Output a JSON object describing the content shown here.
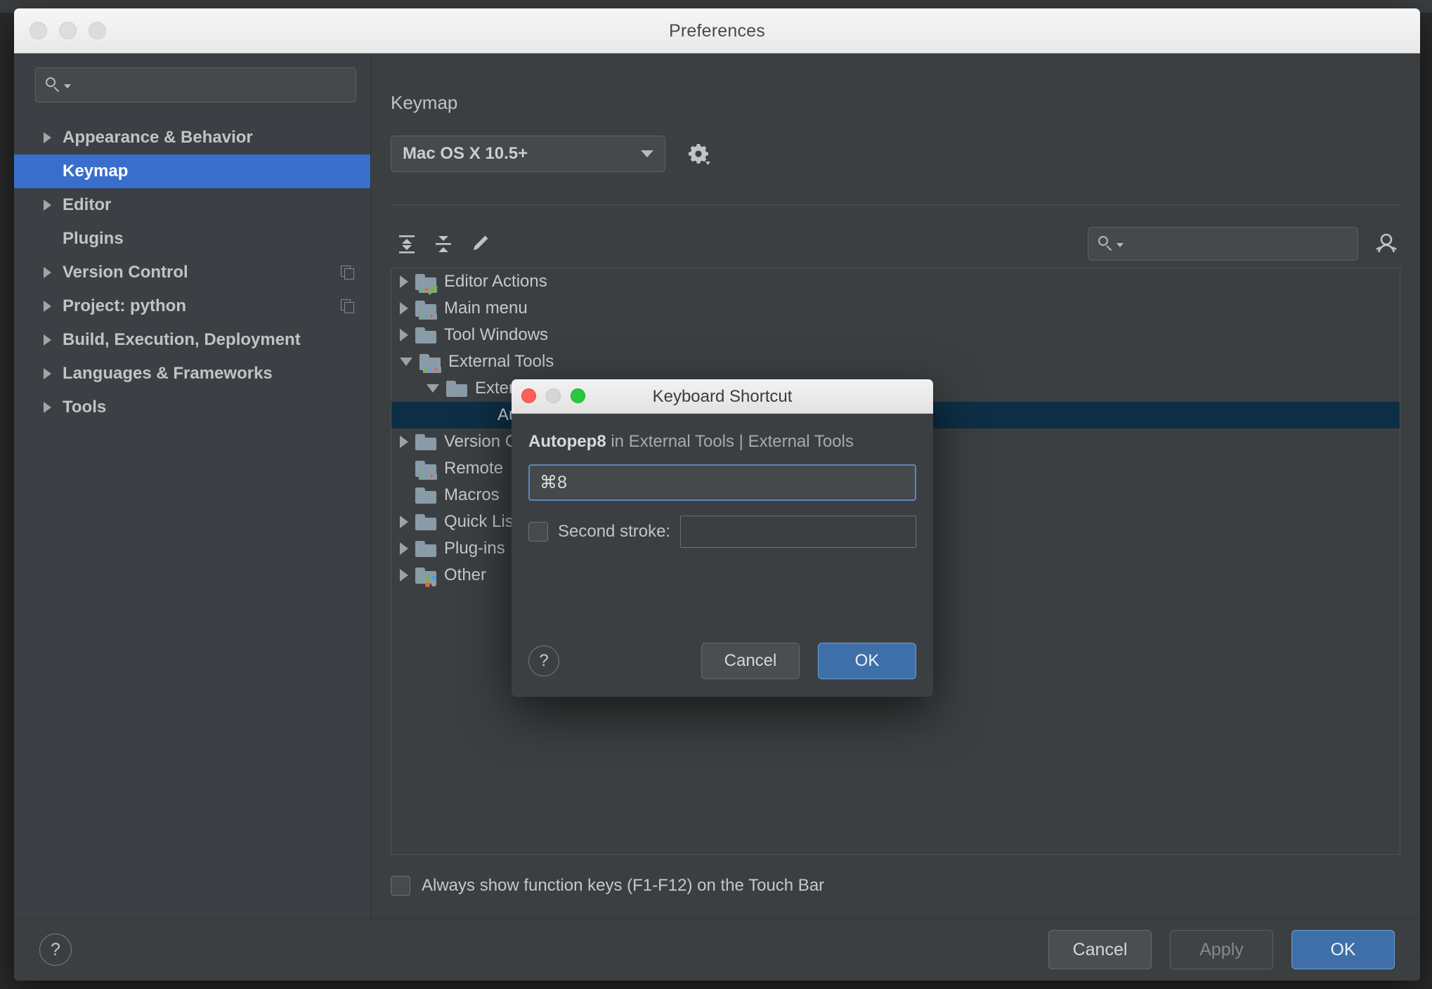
{
  "window": {
    "title": "Preferences",
    "traffic_lights": [
      "close",
      "minimize",
      "zoom"
    ]
  },
  "sidebar": {
    "search": {
      "placeholder": "",
      "value": "",
      "icon": "search-icon"
    },
    "items": [
      {
        "label": "Appearance & Behavior",
        "expandable": true,
        "selected": false,
        "badge": false
      },
      {
        "label": "Keymap",
        "expandable": false,
        "selected": true,
        "badge": false
      },
      {
        "label": "Editor",
        "expandable": true,
        "selected": false,
        "badge": false
      },
      {
        "label": "Plugins",
        "expandable": false,
        "selected": false,
        "badge": false
      },
      {
        "label": "Version Control",
        "expandable": true,
        "selected": false,
        "badge": true
      },
      {
        "label": "Project: python",
        "expandable": true,
        "selected": false,
        "badge": true
      },
      {
        "label": "Build, Execution, Deployment",
        "expandable": true,
        "selected": false,
        "badge": false
      },
      {
        "label": "Languages & Frameworks",
        "expandable": true,
        "selected": false,
        "badge": false
      },
      {
        "label": "Tools",
        "expandable": true,
        "selected": false,
        "badge": false
      }
    ]
  },
  "content": {
    "title": "Keymap",
    "keymap_select": {
      "value": "Mac OS X 10.5+",
      "caret": "chevron-down-icon"
    },
    "gear_icon": "gear-icon",
    "toolbar": {
      "expand_all": "expand-all-icon",
      "collapse_all": "collapse-all-icon",
      "edit": "pencil-icon",
      "search": {
        "placeholder": "",
        "value": "",
        "icon": "search-icon"
      },
      "find_actions": "find-action-icon"
    },
    "tree": [
      {
        "label": "Editor Actions",
        "indent": 0,
        "twisty": "right",
        "icon": "folder-editor-icon",
        "selected": false
      },
      {
        "label": "Main menu",
        "indent": 0,
        "twisty": "right",
        "icon": "folder-menu-icon",
        "selected": false
      },
      {
        "label": "Tool Windows",
        "indent": 0,
        "twisty": "right",
        "icon": "folder-icon",
        "selected": false
      },
      {
        "label": "External Tools",
        "indent": 0,
        "twisty": "down",
        "icon": "folder-menu-icon",
        "selected": false
      },
      {
        "label": "External Tools",
        "indent": 1,
        "twisty": "down",
        "icon": "folder-icon",
        "selected": false
      },
      {
        "label": "Autopep8",
        "indent": 2,
        "twisty": "none",
        "icon": "none",
        "selected": true
      },
      {
        "label": "Version Control",
        "indent": 0,
        "twisty": "right",
        "icon": "folder-icon",
        "selected": false
      },
      {
        "label": "Remote",
        "indent": 0,
        "twisty": "none",
        "icon": "folder-menu-icon",
        "selected": false
      },
      {
        "label": "Macros",
        "indent": 0,
        "twisty": "none",
        "icon": "folder-icon",
        "selected": false
      },
      {
        "label": "Quick Lists",
        "indent": 0,
        "twisty": "right",
        "icon": "folder-icon",
        "selected": false
      },
      {
        "label": "Plug-ins",
        "indent": 0,
        "twisty": "right",
        "icon": "folder-icon",
        "selected": false
      },
      {
        "label": "Other",
        "indent": 0,
        "twisty": "right",
        "icon": "folder-other-icon",
        "selected": false
      }
    ],
    "touchbar_checkbox": {
      "label": "Always show function keys (F1-F12) on the Touch Bar",
      "checked": false
    }
  },
  "footer": {
    "help": "?",
    "cancel_label": "Cancel",
    "apply_label": "Apply",
    "apply_disabled": true,
    "ok_label": "OK"
  },
  "dialog": {
    "title": "Keyboard Shortcut",
    "context_action": "Autopep8",
    "context_rest": " in External Tools | External Tools",
    "first_stroke": {
      "value": "⌘8",
      "placeholder": ""
    },
    "second_stroke": {
      "label": "Second stroke:",
      "checked": false,
      "value": "",
      "placeholder": ""
    },
    "help": "?",
    "cancel_label": "Cancel",
    "ok_label": "OK"
  },
  "colors": {
    "accent_selection": "#3a6ecc",
    "tree_selection": "#0d2f46",
    "primary_button": "#3f6fa8",
    "window_bg": "#3c3f41",
    "sidebar_bg": "#3c4044",
    "focus_border": "#5a87bd"
  }
}
